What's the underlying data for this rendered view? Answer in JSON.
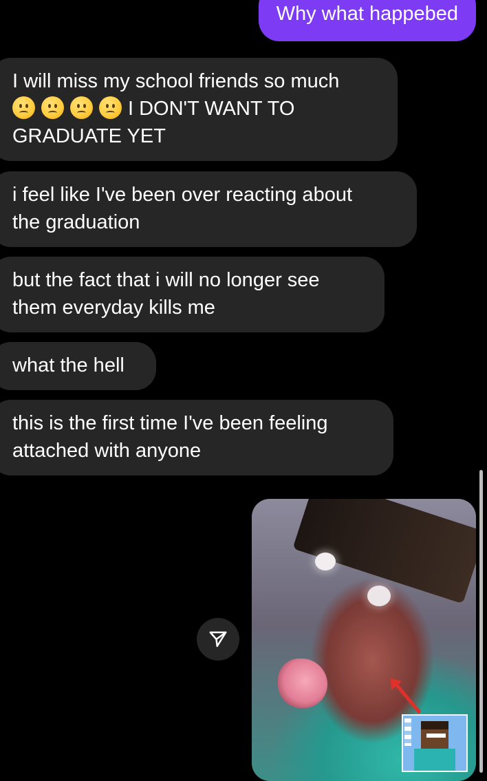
{
  "conversation": {
    "outgoing": [
      {
        "text": "Why what happebed"
      }
    ],
    "incoming": [
      {
        "line1": "I will miss my school friends so much",
        "line2_suffix": "I DON'T WANT TO",
        "line3": "GRADUATE YET",
        "emoji_count": 4,
        "emoji": "slightly-frowning-face"
      },
      {
        "line1": "i feel like I've been over reacting about",
        "line2": "the graduation"
      },
      {
        "line1": "but the fact that i will no longer see",
        "line2": "them everyday kills me"
      },
      {
        "line1": "what the hell"
      },
      {
        "line1": "this is the first time I've been feeling",
        "line2": "attached with anyone"
      }
    ]
  },
  "media_message": {
    "kind": "shared-video-thumbnail",
    "share_icon": "send-arrow-icon"
  },
  "colors": {
    "background": "#000000",
    "outgoing_bubble": "#7d3cf4",
    "incoming_bubble": "#262626",
    "text": "#ffffff",
    "scrollbar": "#bdbdbd"
  }
}
